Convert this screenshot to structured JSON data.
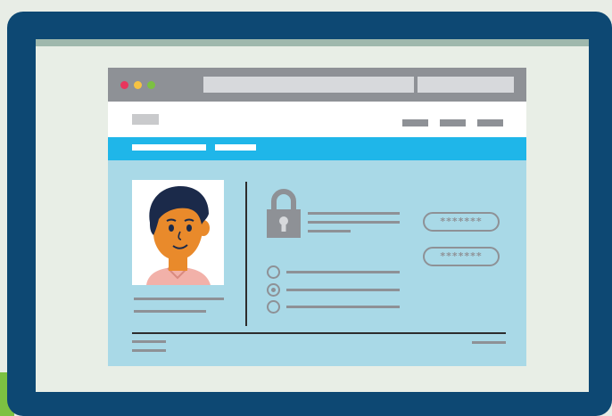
{
  "colors": {
    "monitor_frame": "#0d4873",
    "screen_bg": "#e8eee6",
    "titlebar": "#8e9196",
    "tabbar": "#1fb6e9",
    "content_bg": "#a9d9e7",
    "placeholder_gray": "#8e9196",
    "dot_red": "#e8365d",
    "dot_yellow": "#f6c342",
    "dot_green": "#7cc142"
  },
  "password_fields": [
    {
      "value": "*******"
    },
    {
      "value": "*******"
    }
  ],
  "radio_options": [
    {
      "checked": false
    },
    {
      "checked": true
    },
    {
      "checked": false
    }
  ],
  "icons": {
    "profile": "person-avatar",
    "lock": "lock-icon"
  }
}
